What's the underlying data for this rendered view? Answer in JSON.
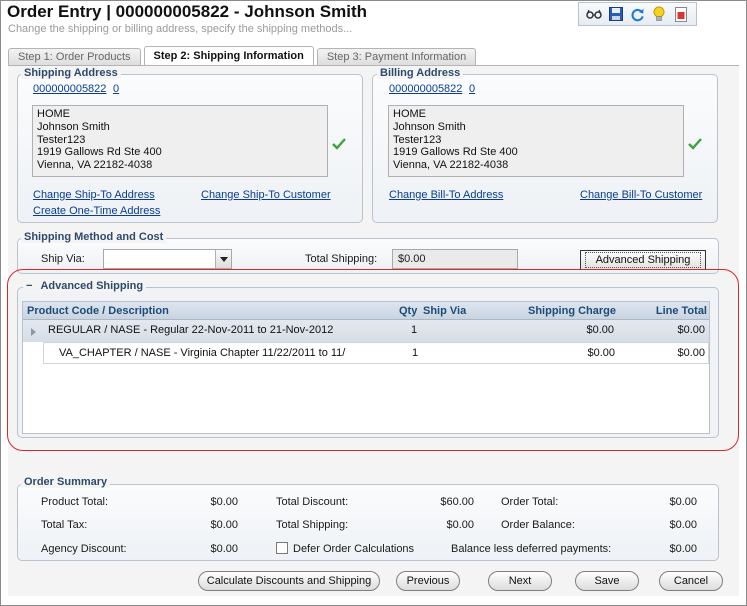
{
  "header": {
    "title": "Order Entry | 000000005822 - Johnson Smith",
    "subtitle": "Change the shipping or billing address, specify the shipping methods..."
  },
  "toolbar": {
    "icons": [
      "glasses-icon",
      "save-icon",
      "refresh-icon",
      "lightbulb-icon",
      "report-icon"
    ]
  },
  "tabs": [
    {
      "label": "Step 1: Order Products",
      "active": false
    },
    {
      "label": "Step 2: Shipping Information",
      "active": true
    },
    {
      "label": "Step 3: Payment Information",
      "active": false
    }
  ],
  "shipping_address": {
    "legend": "Shipping Address",
    "customer_id": "000000005822",
    "customer_seq": "0",
    "lines": [
      "HOME",
      "Johnson Smith",
      "Tester123",
      "1919 Gallows Rd Ste 400",
      "Vienna, VA 22182-4038"
    ],
    "change_address": "Change Ship-To Address",
    "change_customer": "Change Ship-To Customer",
    "one_time": "Create One-Time Address"
  },
  "billing_address": {
    "legend": "Billing Address",
    "customer_id": "000000005822",
    "customer_seq": "0",
    "lines": [
      "HOME",
      "Johnson Smith",
      "Tester123",
      "1919 Gallows Rd Ste 400",
      "Vienna, VA 22182-4038"
    ],
    "change_address": "Change Bill-To Address",
    "change_customer": "Change Bill-To Customer"
  },
  "shipping_method": {
    "legend": "Shipping Method and Cost",
    "ship_via_label": "Ship Via:",
    "ship_via_value": "",
    "total_shipping_label": "Total Shipping:",
    "total_shipping_value": "$0.00",
    "advanced_button": "Advanced Shipping"
  },
  "advanced_shipping": {
    "collapse_glyph": "−",
    "legend": "Advanced Shipping",
    "columns": [
      "Product Code / Description",
      "Qty",
      "Ship Via",
      "Shipping Charge",
      "Line Total"
    ],
    "rows": [
      {
        "description": "REGULAR / NASE - Regular 22-Nov-2011 to 21-Nov-2012",
        "qty": "1",
        "ship_via": "",
        "charge": "$0.00",
        "total": "$0.00"
      },
      {
        "description": "VA_CHAPTER / NASE - Virginia Chapter 11/22/2011 to 11/",
        "qty": "1",
        "ship_via": "",
        "charge": "$0.00",
        "total": "$0.00"
      }
    ]
  },
  "order_summary": {
    "legend": "Order Summary",
    "product_total_label": "Product Total:",
    "product_total": "$0.00",
    "total_tax_label": "Total Tax:",
    "total_tax": "$0.00",
    "agency_discount_label": "Agency Discount:",
    "agency_discount": "$0.00",
    "total_discount_label": "Total Discount:",
    "total_discount": "$60.00",
    "total_shipping_label": "Total Shipping:",
    "total_shipping": "$0.00",
    "defer_label": "Defer Order Calculations",
    "order_total_label": "Order Total:",
    "order_total": "$0.00",
    "order_balance_label": "Order Balance:",
    "order_balance": "$0.00",
    "balance_deferred_label": "Balance less deferred payments:",
    "balance_deferred": "$0.00"
  },
  "buttons": {
    "calculate": "Calculate Discounts and Shipping",
    "previous": "Previous",
    "next": "Next",
    "save": "Save",
    "cancel": "Cancel"
  },
  "colors": {
    "link": "#0a3d91",
    "legend": "#2e4a6b",
    "grid_header_text": "#1f4a78",
    "highlight_outline": "#d42a2a",
    "check": "#3aa63a"
  }
}
